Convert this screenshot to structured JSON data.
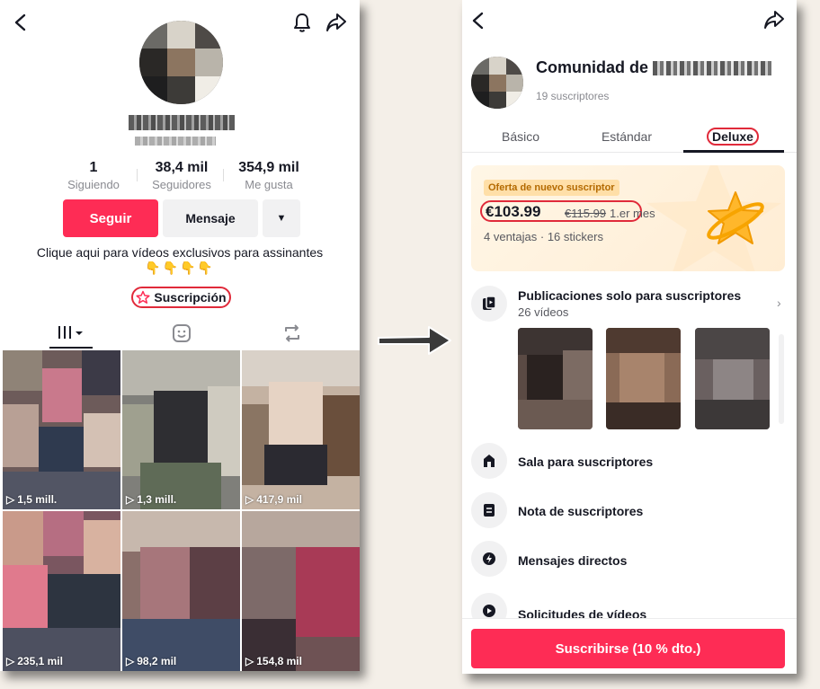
{
  "left": {
    "stats": [
      {
        "value": "1",
        "label": "Siguiendo"
      },
      {
        "value": "38,4 mil",
        "label": "Seguidores"
      },
      {
        "value": "354,9 mil",
        "label": "Me gusta"
      }
    ],
    "follow_label": "Seguir",
    "message_label": "Mensaje",
    "bio_text": "Clique aqui para vídeos exclusivos para assinantes",
    "bio_emoji": "👇👇👇👇",
    "subscription_label": "Suscripción",
    "videos": [
      {
        "views": "1,5 mill."
      },
      {
        "views": "1,3 mill."
      },
      {
        "views": "417,9 mil"
      },
      {
        "views": "235,1 mil"
      },
      {
        "views": "98,2 mil"
      },
      {
        "views": "154,8 mil"
      }
    ]
  },
  "right": {
    "community_title": "Comunidad de",
    "subscribers": "19 suscriptores",
    "tiers": [
      "Básico",
      "Estándar",
      "Deluxe"
    ],
    "active_tier": "Deluxe",
    "offer_tag": "Oferta de nuevo suscriptor",
    "price": "€103.99",
    "price_original": "€115.99",
    "price_period": "1.er mes",
    "offer_info": "4 ventajas · 16 stickers",
    "perks": [
      {
        "title": "Publicaciones solo para suscriptores",
        "subtitle": "26 vídeos",
        "icon": "exclusive-posts-icon"
      },
      {
        "title": "Sala para suscriptores",
        "icon": "subscriber-room-icon"
      },
      {
        "title": "Nota de suscriptores",
        "icon": "subscriber-note-icon"
      },
      {
        "title": "Mensajes directos",
        "icon": "direct-message-icon"
      },
      {
        "title": "Solicitudes de vídeos",
        "icon": "video-request-icon"
      }
    ],
    "subscribe_button": "Suscribirse (10 % dto.)"
  },
  "colors": {
    "accent": "#fe2c55",
    "highlight_ring": "#e02a3a",
    "offer_bg": "#fff2de"
  }
}
